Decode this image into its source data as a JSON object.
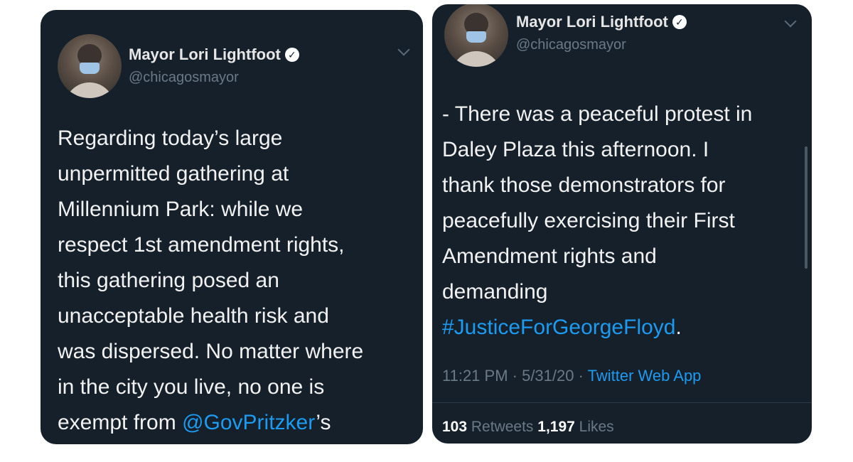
{
  "tweets": [
    {
      "author_name": "Mayor Lori Lightfoot",
      "handle": "@chicagosmayor",
      "text_lines": [
        "Regarding today’s large",
        "unpermitted gathering at",
        "Millennium Park: while we",
        "respect 1st amendment rights,",
        "this gathering posed an",
        "unacceptable health risk and",
        "was dispersed. No matter where",
        "in the city you live, no one is",
        "exempt from "
      ],
      "mention": "@GovPritzker",
      "mention_suffix": "’s"
    },
    {
      "author_name": "Mayor Lori Lightfoot",
      "handle": "@chicagosmayor",
      "text_lines": [
        "- There was a peaceful protest in",
        "Daley Plaza this afternoon. I",
        "thank those demonstrators for",
        "peacefully exercising their First",
        "Amendment rights and",
        "demanding"
      ],
      "hashtag": "#JusticeForGeorgeFloyd",
      "hashtag_suffix": ".",
      "time": "11:21 PM · 5/31/20 · ",
      "source_app": "Twitter Web App",
      "retweets_count": "103",
      "retweets_label": " Retweets ",
      "likes_count": "1,197",
      "likes_label": " Likes"
    }
  ],
  "icons": {
    "verified": "verified-badge-icon",
    "chevron": "chevron-down-icon"
  },
  "colors": {
    "card_background": "#15202b",
    "link": "#1d9bf0",
    "muted": "#6b7a87"
  }
}
